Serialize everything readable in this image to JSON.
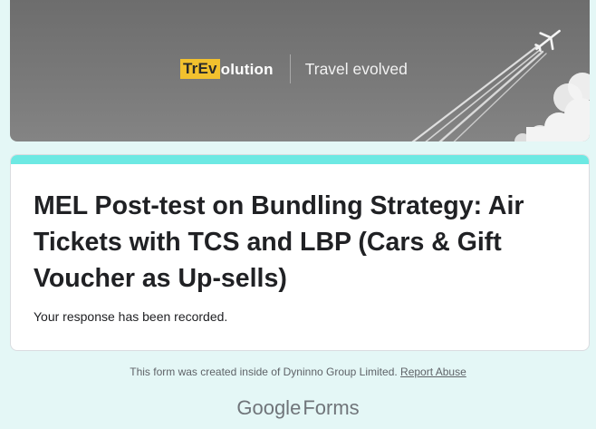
{
  "banner": {
    "logo_highlight": "TrEv",
    "logo_rest": "olution",
    "tagline": "Travel evolved"
  },
  "form": {
    "title": "MEL Post-test on Bundling Strategy: Air Tickets with TCS and LBP (Cars & Gift Voucher as Up-sells)",
    "confirmation": "Your response has been recorded.",
    "accent_color": "#6de9e3"
  },
  "footer": {
    "note": "This form was created inside of Dyninno Group Limited.",
    "report_link": "Report Abuse",
    "brand_google": "Google",
    "brand_forms": "Forms"
  },
  "icons": [
    "airplane-icon"
  ]
}
